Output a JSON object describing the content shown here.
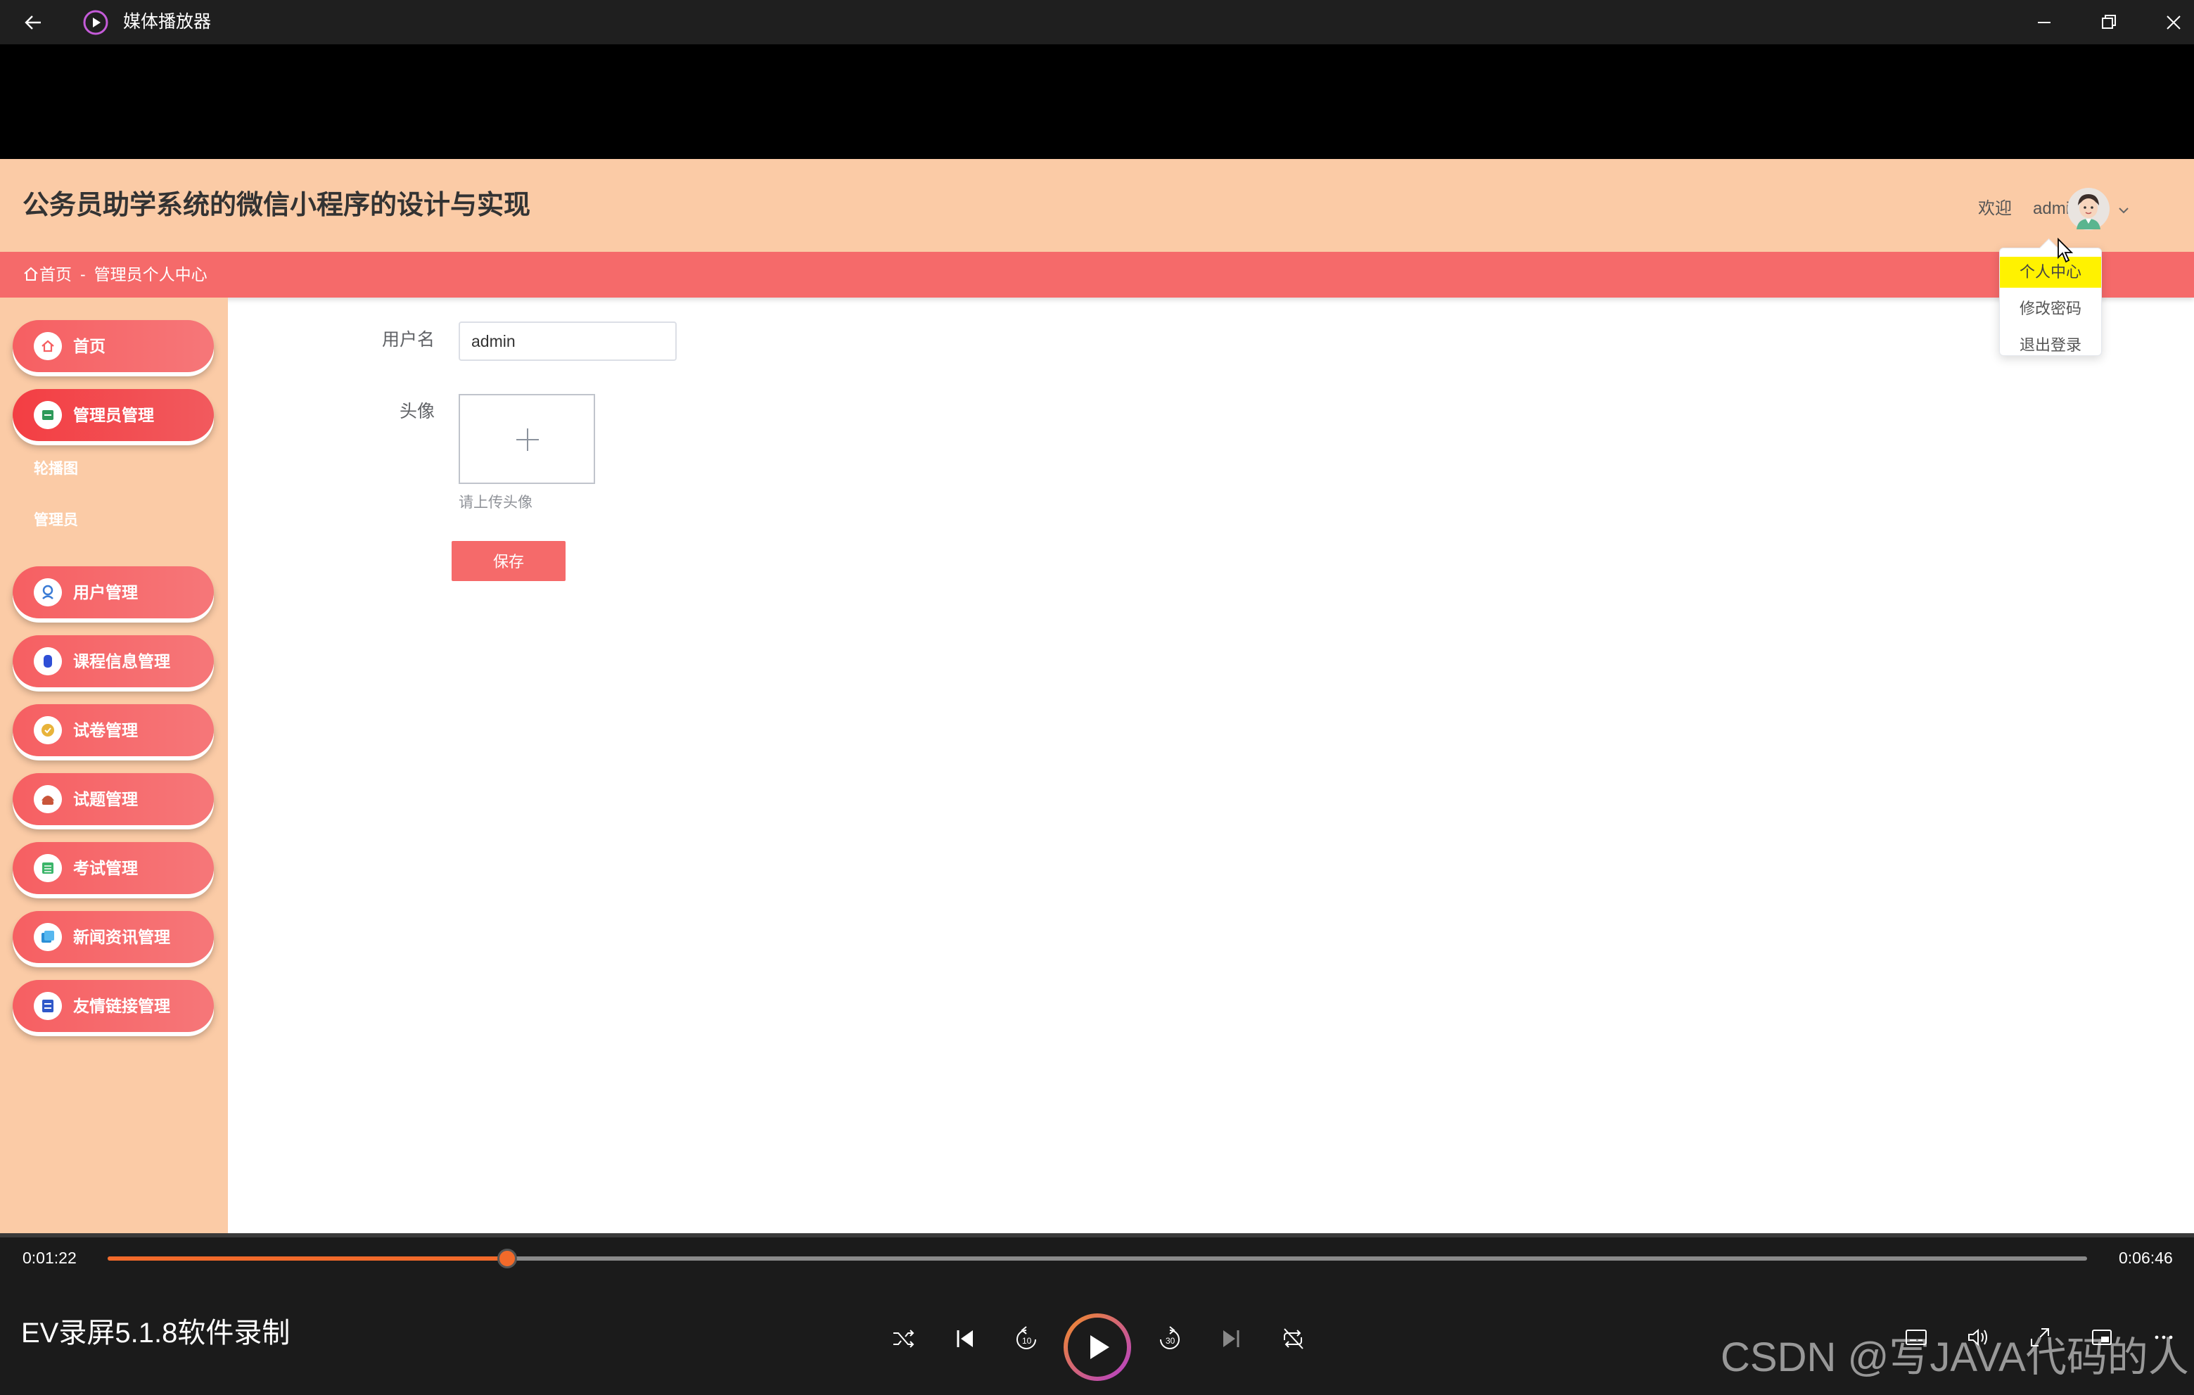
{
  "window": {
    "title": "媒体播放器"
  },
  "app": {
    "title": "公务员助学系统的微信小程序的设计与实现",
    "welcome_text": "欢迎",
    "user_name": "admin",
    "breadcrumb": {
      "home": "首页",
      "separator": "-",
      "current": "管理员个人中心"
    },
    "sidebar": {
      "items": [
        {
          "label": "首页",
          "icon": "home-icon"
        },
        {
          "label": "管理员管理",
          "icon": "admin-icon",
          "sub_items": [
            "轮播图",
            "管理员"
          ]
        },
        {
          "label": "用户管理",
          "icon": "user-icon"
        },
        {
          "label": "课程信息管理",
          "icon": "course-icon"
        },
        {
          "label": "试卷管理",
          "icon": "paper-icon"
        },
        {
          "label": "试题管理",
          "icon": "question-icon"
        },
        {
          "label": "考试管理",
          "icon": "exam-icon"
        },
        {
          "label": "新闻资讯管理",
          "icon": "news-icon"
        },
        {
          "label": "友情链接管理",
          "icon": "link-icon"
        }
      ]
    },
    "form": {
      "username_label": "用户名",
      "username_value": "admin",
      "avatar_label": "头像",
      "upload_hint": "请上传头像",
      "save_label": "保存"
    },
    "dropdown": {
      "items": [
        "个人中心",
        "修改密码",
        "退出登录"
      ],
      "highlighted_index": 0
    }
  },
  "player": {
    "current_time": "0:01:22",
    "total_time": "0:06:46",
    "progress_fraction": 0.202,
    "recorder_label": "EV录屏5.1.8软件录制",
    "watermark": "CSDN @写JAVA代码的人"
  },
  "colors": {
    "header_bg": "#fbcba6",
    "accent": "#f56a6a",
    "progress": "#f26a2a"
  }
}
